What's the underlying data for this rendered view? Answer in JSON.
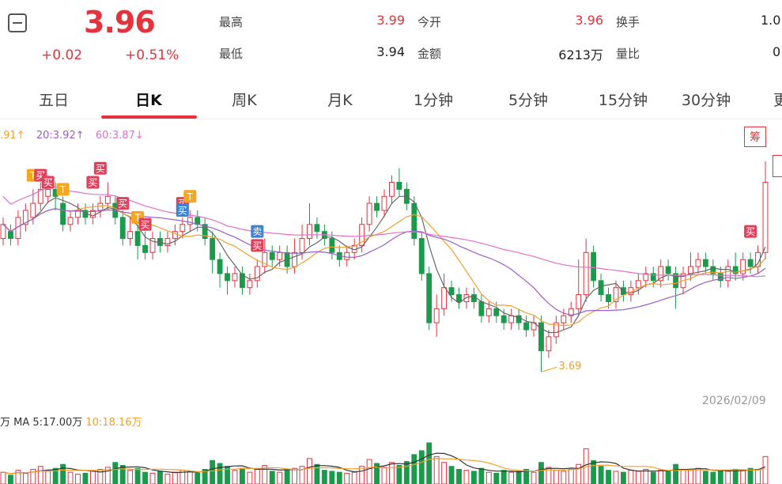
{
  "header": {
    "price": "3.96",
    "change": "+0.02",
    "change_pct": "+0.51%",
    "stats": [
      {
        "label": "最高",
        "value": "3.99",
        "color": "#e6323c"
      },
      {
        "label": "今开",
        "value": "3.96",
        "color": "#e6323c"
      },
      {
        "label": "换手",
        "value": "1.0"
      },
      {
        "label": "最低",
        "value": "3.94",
        "color": "#222222"
      },
      {
        "label": "金额",
        "value": "6213万",
        "color": "#222222"
      },
      {
        "label": "量比",
        "value": "0"
      }
    ]
  },
  "tabs": [
    "五日",
    "日K",
    "周K",
    "月K",
    "1分钟",
    "5分钟",
    "15分钟",
    "30分钟",
    "更"
  ],
  "active_tab": "日K",
  "legend": {
    "ma10": ".91↑",
    "ma20": "20:3.92↑",
    "ma60": "60:3.87↓",
    "ma10_color": "#f0a030",
    "ma20_color": "#9b5ec8",
    "ma60_color": "#e070c8",
    "down_arrow_color": "#1a9a4a"
  },
  "chip_button": "筹",
  "date_label": "2026/02/09",
  "low_label": "3.69",
  "volume_legend": {
    "prefix": "万",
    "ma5": "MA 5:17.00万",
    "ma10": "10:18.16万",
    "ma10_color": "#f0a030"
  },
  "colors": {
    "up": "#e6323c",
    "down": "#1a9a4a",
    "buy_tag": "#e0405a",
    "t_tag": "#f5a623",
    "sell_tag": "#3c82d2"
  },
  "chart_data": {
    "type": "candlestick",
    "y_range": [
      3.67,
      4.0
    ],
    "candles": [
      [
        3.88,
        3.9,
        3.87,
        3.91
      ],
      [
        3.89,
        3.88,
        3.87,
        3.9
      ],
      [
        3.88,
        3.91,
        3.87,
        3.92
      ],
      [
        3.9,
        3.92,
        3.89,
        3.93
      ],
      [
        3.91,
        3.93,
        3.9,
        3.95
      ],
      [
        3.93,
        3.95,
        3.92,
        3.96
      ],
      [
        3.94,
        3.95,
        3.93,
        3.97
      ],
      [
        3.95,
        3.94,
        3.92,
        3.96
      ],
      [
        3.93,
        3.9,
        3.89,
        3.94
      ],
      [
        3.9,
        3.91,
        3.89,
        3.92
      ],
      [
        3.91,
        3.92,
        3.9,
        3.93
      ],
      [
        3.92,
        3.91,
        3.9,
        3.93
      ],
      [
        3.91,
        3.92,
        3.9,
        3.93
      ],
      [
        3.92,
        3.93,
        3.91,
        3.94
      ],
      [
        3.93,
        3.94,
        3.92,
        3.96
      ],
      [
        3.93,
        3.91,
        3.9,
        3.94
      ],
      [
        3.91,
        3.88,
        3.87,
        3.92
      ],
      [
        3.88,
        3.89,
        3.87,
        3.91
      ],
      [
        3.89,
        3.87,
        3.85,
        3.9
      ],
      [
        3.87,
        3.86,
        3.85,
        3.89
      ],
      [
        3.86,
        3.88,
        3.85,
        3.89
      ],
      [
        3.88,
        3.87,
        3.86,
        3.89
      ],
      [
        3.87,
        3.88,
        3.86,
        3.89
      ],
      [
        3.88,
        3.89,
        3.87,
        3.9
      ],
      [
        3.89,
        3.9,
        3.88,
        3.91
      ],
      [
        3.9,
        3.91,
        3.89,
        3.92
      ],
      [
        3.91,
        3.9,
        3.89,
        3.92
      ],
      [
        3.9,
        3.88,
        3.87,
        3.91
      ],
      [
        3.88,
        3.85,
        3.83,
        3.89
      ],
      [
        3.85,
        3.83,
        3.81,
        3.86
      ],
      [
        3.83,
        3.82,
        3.8,
        3.84
      ],
      [
        3.82,
        3.83,
        3.81,
        3.84
      ],
      [
        3.83,
        3.81,
        3.8,
        3.84
      ],
      [
        3.81,
        3.82,
        3.8,
        3.83
      ],
      [
        3.82,
        3.84,
        3.81,
        3.85
      ],
      [
        3.84,
        3.86,
        3.83,
        3.88
      ],
      [
        3.86,
        3.85,
        3.84,
        3.87
      ],
      [
        3.85,
        3.86,
        3.84,
        3.87
      ],
      [
        3.86,
        3.84,
        3.83,
        3.87
      ],
      [
        3.84,
        3.86,
        3.83,
        3.88
      ],
      [
        3.86,
        3.88,
        3.85,
        3.9
      ],
      [
        3.88,
        3.9,
        3.87,
        3.93
      ],
      [
        3.9,
        3.89,
        3.88,
        3.91
      ],
      [
        3.89,
        3.88,
        3.87,
        3.9
      ],
      [
        3.88,
        3.86,
        3.85,
        3.89
      ],
      [
        3.86,
        3.85,
        3.84,
        3.87
      ],
      [
        3.85,
        3.86,
        3.84,
        3.87
      ],
      [
        3.86,
        3.87,
        3.85,
        3.88
      ],
      [
        3.87,
        3.9,
        3.86,
        3.91
      ],
      [
        3.9,
        3.93,
        3.89,
        3.94
      ],
      [
        3.93,
        3.92,
        3.91,
        3.94
      ],
      [
        3.92,
        3.94,
        3.91,
        3.95
      ],
      [
        3.94,
        3.96,
        3.93,
        3.97
      ],
      [
        3.96,
        3.95,
        3.94,
        3.98
      ],
      [
        3.95,
        3.93,
        3.92,
        3.96
      ],
      [
        3.93,
        3.88,
        3.87,
        3.94
      ],
      [
        3.88,
        3.83,
        3.82,
        3.89
      ],
      [
        3.83,
        3.76,
        3.75,
        3.84
      ],
      [
        3.76,
        3.78,
        3.74,
        3.8
      ],
      [
        3.78,
        3.81,
        3.77,
        3.83
      ],
      [
        3.81,
        3.8,
        3.79,
        3.82
      ],
      [
        3.8,
        3.79,
        3.78,
        3.81
      ],
      [
        3.79,
        3.8,
        3.78,
        3.81
      ],
      [
        3.8,
        3.79,
        3.78,
        3.81
      ],
      [
        3.79,
        3.77,
        3.76,
        3.8
      ],
      [
        3.77,
        3.78,
        3.76,
        3.79
      ],
      [
        3.78,
        3.77,
        3.76,
        3.79
      ],
      [
        3.77,
        3.76,
        3.75,
        3.78
      ],
      [
        3.76,
        3.77,
        3.75,
        3.78
      ],
      [
        3.77,
        3.76,
        3.75,
        3.78
      ],
      [
        3.76,
        3.75,
        3.74,
        3.77
      ],
      [
        3.75,
        3.76,
        3.74,
        3.77
      ],
      [
        3.76,
        3.72,
        3.69,
        3.77
      ],
      [
        3.72,
        3.74,
        3.71,
        3.75
      ],
      [
        3.74,
        3.76,
        3.73,
        3.77
      ],
      [
        3.76,
        3.77,
        3.75,
        3.78
      ],
      [
        3.77,
        3.78,
        3.76,
        3.79
      ],
      [
        3.78,
        3.8,
        3.77,
        3.85
      ],
      [
        3.8,
        3.86,
        3.79,
        3.88
      ],
      [
        3.86,
        3.82,
        3.81,
        3.87
      ],
      [
        3.82,
        3.8,
        3.79,
        3.83
      ],
      [
        3.8,
        3.79,
        3.78,
        3.81
      ],
      [
        3.79,
        3.81,
        3.78,
        3.82
      ],
      [
        3.81,
        3.8,
        3.79,
        3.82
      ],
      [
        3.8,
        3.81,
        3.79,
        3.82
      ],
      [
        3.81,
        3.82,
        3.8,
        3.83
      ],
      [
        3.82,
        3.83,
        3.81,
        3.84
      ],
      [
        3.83,
        3.82,
        3.81,
        3.84
      ],
      [
        3.82,
        3.84,
        3.81,
        3.85
      ],
      [
        3.84,
        3.83,
        3.82,
        3.85
      ],
      [
        3.83,
        3.81,
        3.78,
        3.84
      ],
      [
        3.81,
        3.83,
        3.8,
        3.84
      ],
      [
        3.83,
        3.84,
        3.82,
        3.86
      ],
      [
        3.84,
        3.85,
        3.83,
        3.86
      ],
      [
        3.85,
        3.84,
        3.83,
        3.86
      ],
      [
        3.84,
        3.83,
        3.82,
        3.85
      ],
      [
        3.83,
        3.82,
        3.81,
        3.84
      ],
      [
        3.82,
        3.84,
        3.81,
        3.85
      ],
      [
        3.84,
        3.83,
        3.82,
        3.86
      ],
      [
        3.83,
        3.85,
        3.82,
        3.86
      ],
      [
        3.85,
        3.84,
        3.83,
        3.86
      ],
      [
        3.84,
        3.86,
        3.83,
        3.87
      ],
      [
        3.86,
        3.96,
        3.85,
        3.99
      ]
    ],
    "volumes": [
      12,
      9,
      14,
      11,
      15,
      18,
      13,
      16,
      20,
      12,
      10,
      11,
      13,
      15,
      17,
      22,
      19,
      14,
      16,
      12,
      11,
      13,
      10,
      12,
      14,
      13,
      11,
      15,
      24,
      21,
      18,
      14,
      16,
      12,
      15,
      19,
      13,
      12,
      14,
      16,
      18,
      26,
      20,
      14,
      13,
      12,
      11,
      12,
      18,
      25,
      21,
      17,
      22,
      19,
      23,
      30,
      34,
      42,
      28,
      22,
      18,
      15,
      14,
      13,
      16,
      12,
      11,
      14,
      12,
      13,
      15,
      12,
      22,
      17,
      14,
      13,
      15,
      20,
      36,
      24,
      18,
      14,
      13,
      12,
      14,
      13,
      15,
      12,
      14,
      13,
      20,
      15,
      14,
      16,
      13,
      12,
      14,
      13,
      15,
      14,
      16,
      15,
      28
    ]
  }
}
